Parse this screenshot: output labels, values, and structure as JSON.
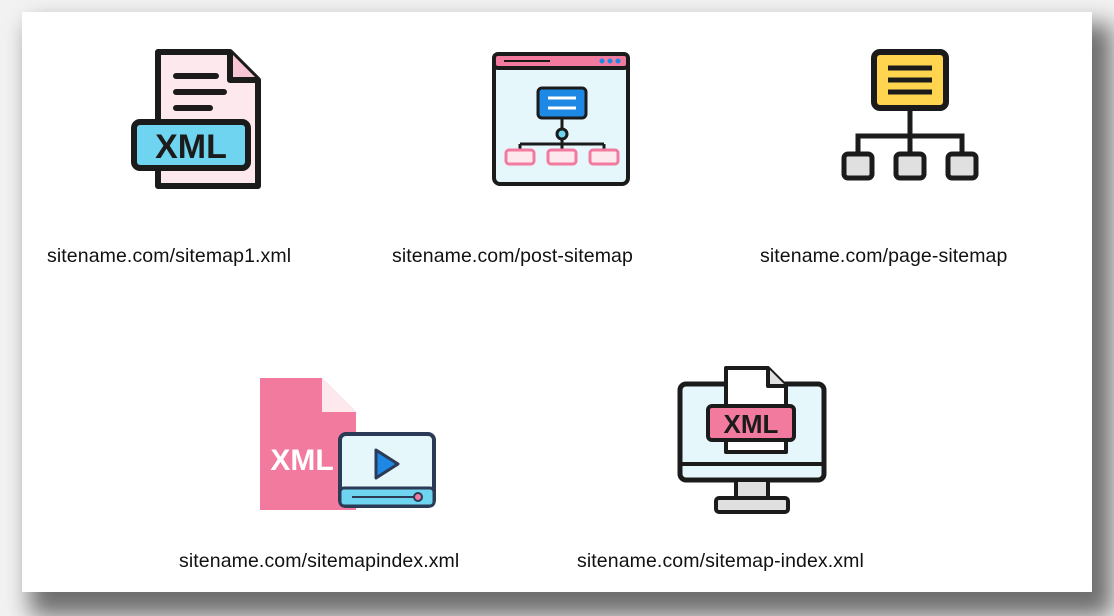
{
  "items": [
    {
      "label": "sitename.com/sitemap1.xml",
      "icon": "xml-file-icon",
      "icon_text": "XML"
    },
    {
      "label": "sitename.com/post-sitemap",
      "icon": "browser-sitemap-icon"
    },
    {
      "label": "sitename.com/page-sitemap",
      "icon": "hierarchy-tree-icon"
    },
    {
      "label": "sitename.com/sitemapindex.xml",
      "icon": "xml-video-file-icon",
      "icon_text": "XML"
    },
    {
      "label": "sitename.com/sitemap-index.xml",
      "icon": "monitor-xml-icon",
      "icon_text": "XML"
    }
  ],
  "colors": {
    "outline": "#1b1b1b",
    "cyan": "#6fd4f0",
    "pink": "#f27a9f",
    "light_pink": "#fde8ee",
    "light_blue": "#e6f7fb",
    "blue": "#1e88e5",
    "yellow": "#ffd54f",
    "gray": "#e0e0e0"
  }
}
